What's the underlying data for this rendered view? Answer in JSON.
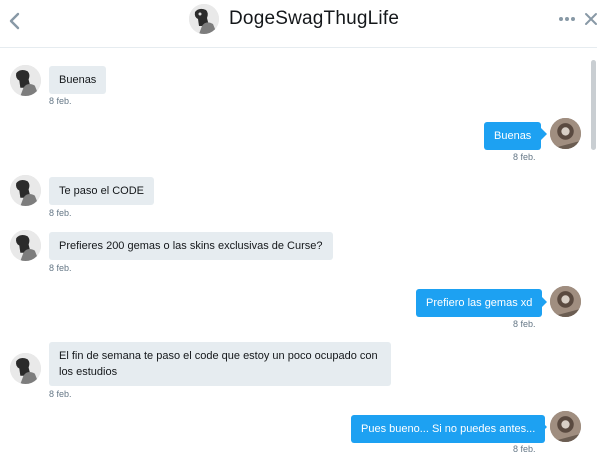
{
  "header": {
    "title": "DogeSwagThugLife",
    "back_icon": "chevron-left-icon",
    "more_icon": "more-icon",
    "close_icon": "close-icon"
  },
  "colors": {
    "sent_bubble": "#1da1f2",
    "received_bubble": "#e6ecf0",
    "timestamp": "#657786"
  },
  "messages": [
    {
      "from": "them",
      "text": "Buenas",
      "time": "8 feb."
    },
    {
      "from": "me",
      "text": "Buenas",
      "time": "8 feb."
    },
    {
      "from": "them",
      "text": "Te paso el CODE",
      "time": "8 feb."
    },
    {
      "from": "them",
      "text": "Prefieres 200 gemas o las skins exclusivas de Curse?",
      "time": "8 feb."
    },
    {
      "from": "me",
      "text": "Prefiero las gemas xd",
      "time": "8 feb."
    },
    {
      "from": "them",
      "text": "El fin de semana te paso el code que estoy un poco ocupado con los estudios",
      "time": "8 feb."
    },
    {
      "from": "me",
      "text": "Pues bueno... Si no puedes antes...",
      "time": "8 feb."
    }
  ]
}
